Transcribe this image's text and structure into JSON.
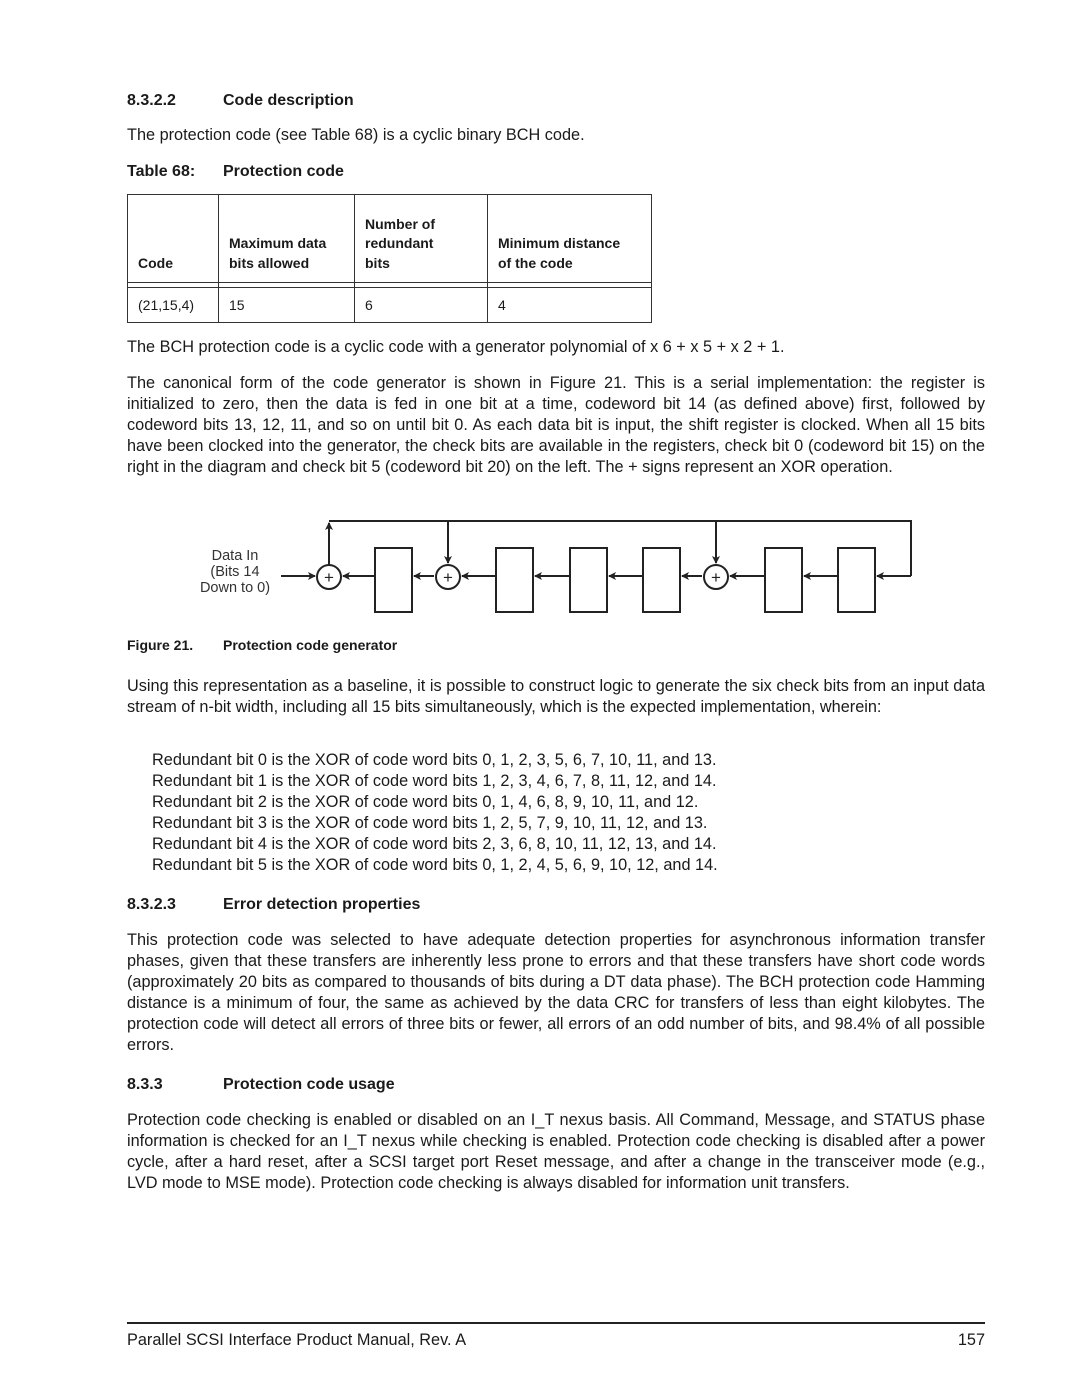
{
  "section_822": {
    "number": "8.3.2.2",
    "title": "Code description"
  },
  "intro": "The protection code (see Table 68) is a cyclic binary BCH code.",
  "table68": {
    "label": "Table 68:",
    "title": "Protection code",
    "headers": [
      "Code",
      "Maximum data bits allowed",
      "Number of redundant bits",
      "Minimum distance of the code"
    ],
    "header_lines": [
      [
        "Code"
      ],
      [
        "Maximum data",
        "bits allowed"
      ],
      [
        "Number of",
        "redundant",
        "bits"
      ],
      [
        "Minimum distance",
        "of the code"
      ]
    ],
    "rows": [
      [
        "(21,15,4)",
        "15",
        "6",
        "4"
      ]
    ]
  },
  "para_polynomial": "The BCH protection code is a cyclic code with a generator polynomial of x 6 + x 5 + x 2 + 1.",
  "para_canonical": "The canonical form of the code generator is shown in Figure 21. This is a serial implementation: the register is initialized to zero, then the data is fed in one bit at a time, codeword bit 14 (as defined above) first, followed by codeword bits 13, 12, 11, and so on until bit 0. As each data bit is input, the shift register is clocked. When all 15 bits have been clocked into the generator, the check bits are available in the registers, check bit 0 (codeword bit 15) on the right in the diagram and check bit 5 (codeword bit 20) on the left. The + signs represent an XOR operation.",
  "figure21": {
    "input_label_lines": [
      "Data In",
      "(Bits 14",
      "Down to 0)"
    ],
    "xor_symbol": "+",
    "caption_number": "Figure 21.",
    "caption_title": "Protection code generator",
    "register_count": 6,
    "xor_count": 3
  },
  "para_baseline": "Using this representation as a baseline, it is possible to construct logic to generate the six check bits from an input data stream of n-bit width, including all 15 bits simultaneously, which is the expected implementation, wherein:",
  "redundant_bits": [
    "Redundant bit 0 is the XOR of code word bits 0, 1, 2, 3, 5, 6, 7, 10, 11, and 13.",
    "Redundant bit 1 is the XOR of code word bits 1, 2, 3, 4, 6, 7, 8, 11, 12, and 14.",
    "Redundant bit 2 is the XOR of code word bits 0, 1, 4, 6, 8, 9, 10, 11, and 12.",
    "Redundant bit 3 is the XOR of code word bits 1, 2, 5, 7, 9, 10, 11, 12, and 13.",
    "Redundant bit 4 is the XOR of code word bits 2, 3, 6, 8, 10, 11, 12, 13, and 14.",
    "Redundant bit 5 is the XOR of code word bits 0, 1, 2, 4, 5, 6, 9, 10, 12, and 14."
  ],
  "section_823": {
    "number": "8.3.2.3",
    "title": "Error detection properties"
  },
  "para_error": "This protection code was selected to have adequate detection properties for asynchronous information transfer phases, given that these transfers are inherently less prone to errors and that these transfers have short code words (approximately 20 bits as compared to thousands of bits during a DT data phase). The BCH protection code Hamming distance is a minimum of four, the same as achieved by the data CRC for transfers of less than eight kilobytes. The protection code will detect all errors of three bits or fewer, all errors of an odd number of bits, and 98.4% of all possible errors.",
  "section_833": {
    "number": "8.3.3",
    "title": "Protection code usage"
  },
  "para_usage": "Protection code checking is enabled or disabled on an I_T nexus basis. All Command, Message, and STATUS phase information is checked for an I_T nexus while checking is enabled. Protection code checking is disabled after a power cycle, after a hard reset, after a SCSI target port Reset message, and after a change in the transceiver mode (e.g., LVD mode to MSE mode). Protection code checking is always disabled for information unit transfers.",
  "footer": {
    "title": "Parallel SCSI Interface Product Manual, Rev. A",
    "page": "157"
  }
}
